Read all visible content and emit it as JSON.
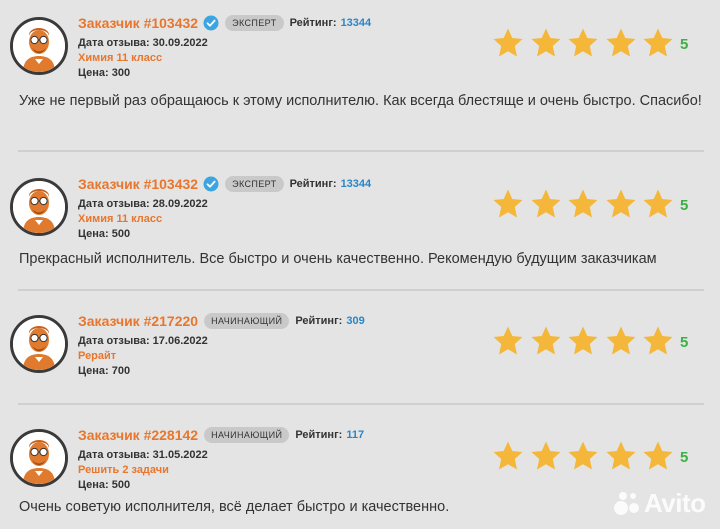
{
  "reviews": [
    {
      "customer": "Заказчик #103432",
      "verified": true,
      "badge": "ЭКСПЕРТ",
      "rating_label": "Рейтинг:",
      "rating_value": "13344",
      "date_label": "Дата отзыва: 30.09.2022",
      "subject": "Химия 11 класс",
      "price_label": "Цена: 300",
      "stars": 5,
      "score": "5",
      "text": "Уже не первый раз обращаюсь к этому исполнителю. Как всегда блестяще и очень быстро. Спасибо!"
    },
    {
      "customer": "Заказчик #103432",
      "verified": true,
      "badge": "ЭКСПЕРТ",
      "rating_label": "Рейтинг:",
      "rating_value": "13344",
      "date_label": "Дата отзыва: 28.09.2022",
      "subject": "Химия 11 класс",
      "price_label": "Цена: 500",
      "stars": 5,
      "score": "5",
      "text": "Прекрасный исполнитель. Все быстро и очень качественно. Рекомендую будущим заказчикам"
    },
    {
      "customer": "Заказчик #217220",
      "verified": false,
      "badge": "НАЧИНАЮЩИЙ",
      "rating_label": "Рейтинг:",
      "rating_value": "309",
      "date_label": "Дата отзыва: 17.06.2022",
      "subject": "Рерайт",
      "price_label": "Цена: 700",
      "stars": 5,
      "score": "5",
      "text": ""
    },
    {
      "customer": "Заказчик #228142",
      "verified": false,
      "badge": "НАЧИНАЮЩИЙ",
      "rating_label": "Рейтинг:",
      "rating_value": "117",
      "date_label": "Дата отзыва: 31.05.2022",
      "subject": "Решить 2 задачи",
      "price_label": "Цена: 500",
      "stars": 5,
      "score": "5",
      "text": "Очень советую исполнителя, всё делает быстро и качественно."
    }
  ],
  "watermark": "Avito",
  "colors": {
    "customer": "#e8762c",
    "rating_value": "#2a86c8",
    "score": "#3cb043",
    "star": "#f4b73a",
    "verified": "#3aa5e0",
    "avatar_orange": "#e07a2e"
  }
}
